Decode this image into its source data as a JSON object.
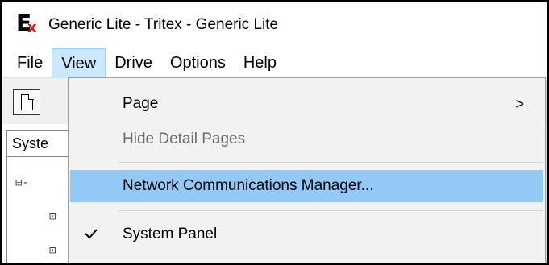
{
  "window": {
    "title": "Generic Lite - Tritex - Generic Lite",
    "icon": "app-logo-icon",
    "icon_letters": "EX"
  },
  "menubar": {
    "items": [
      {
        "label": "File"
      },
      {
        "label": "View",
        "active": true
      },
      {
        "label": "Drive"
      },
      {
        "label": "Options"
      },
      {
        "label": "Help"
      }
    ]
  },
  "toolbar": {
    "buttons": [
      {
        "icon": "new-page-icon"
      }
    ]
  },
  "left_panel": {
    "tab_label": "Syste",
    "tree_glyphs": [
      "⊟-",
      "⊡",
      "⊡"
    ]
  },
  "view_menu": {
    "items": [
      {
        "label": "Page",
        "submenu_arrow": ">",
        "enabled": true
      },
      {
        "label": "Hide Detail Pages",
        "enabled": false
      },
      {
        "label": "Network Communications Manager...",
        "enabled": true,
        "highlighted": true
      },
      {
        "label": "System Panel",
        "enabled": true,
        "checked": true
      }
    ]
  },
  "colors": {
    "menu_active_bg": "#cce8ff",
    "menu_highlight_bg": "#91c9f7",
    "dropdown_bg": "#f2f2f2",
    "disabled_text": "#6d6d6d",
    "logo_x": "#e01818"
  }
}
